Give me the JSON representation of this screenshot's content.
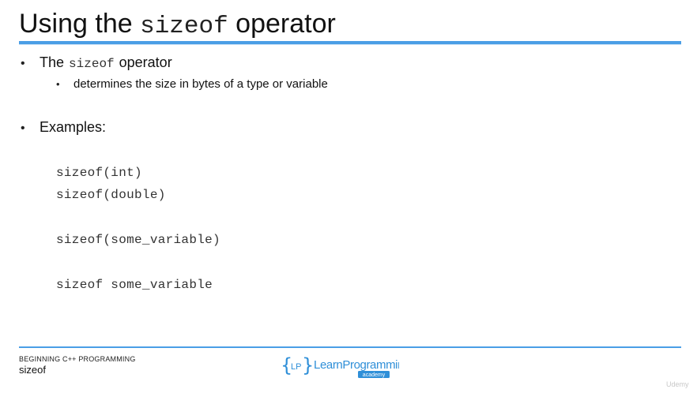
{
  "slide": {
    "title_prefix": "Using the",
    "title_code": "sizeof",
    "title_suffix": "operator",
    "bullets": [
      {
        "prefix": "The",
        "code": "sizeof",
        "suffix": "operator"
      },
      {
        "text": "determines the size in bytes of a type or variable"
      },
      {
        "text": "Examples:"
      }
    ],
    "code_examples": [
      "sizeof(int)",
      "sizeof(double)",
      "sizeof(some_variable)",
      "sizeof some_variable"
    ]
  },
  "footer": {
    "course": "BEGINNING C++ PROGRAMMING",
    "topic": "sizeof",
    "logo_main": "LearnProgramming",
    "logo_sub": "academy",
    "logo_mark": "LP",
    "watermark": "Udemy"
  },
  "colors": {
    "accent_blue": "#4a9ee6",
    "logo_blue": "#2f8fd8",
    "text": "#111111"
  }
}
